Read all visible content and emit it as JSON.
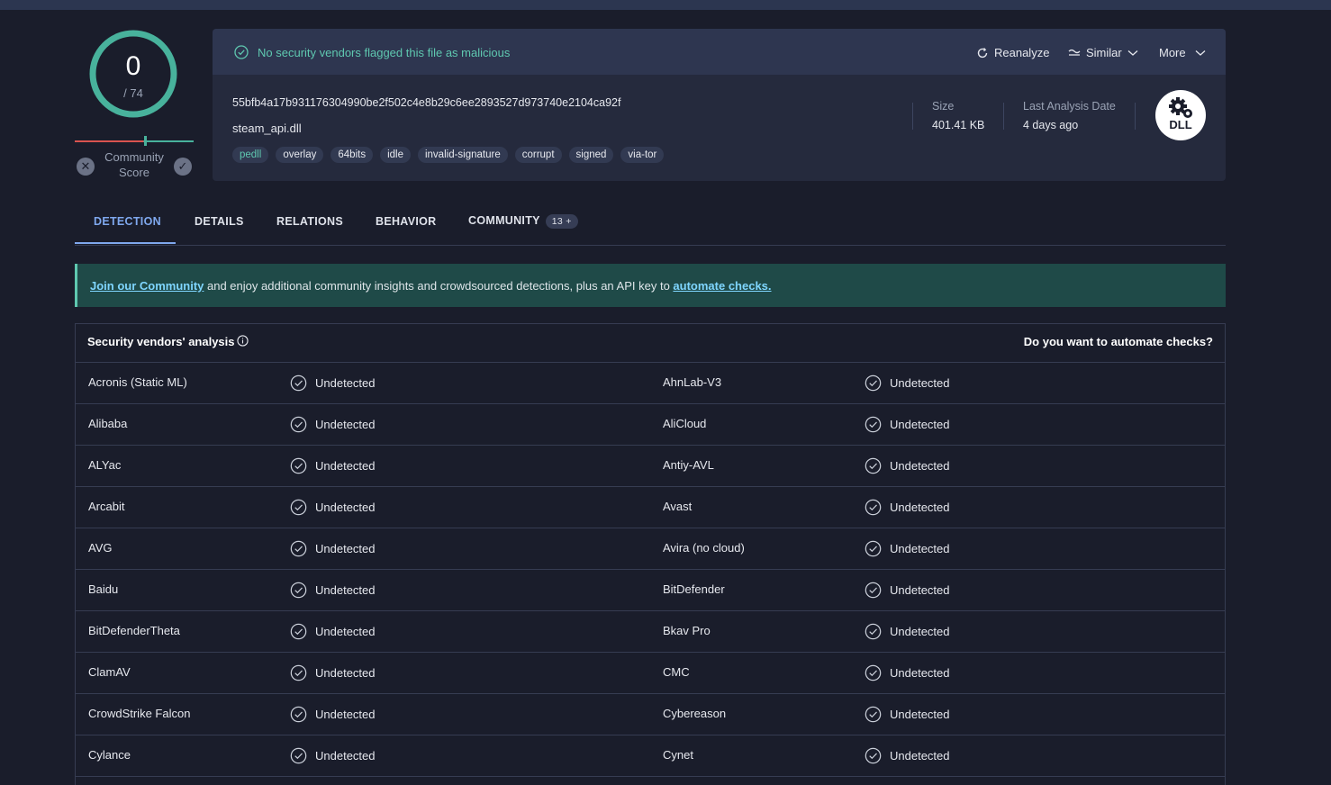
{
  "score": {
    "detected": "0",
    "total": "/ 74",
    "community_label_1": "Community",
    "community_label_2": "Score"
  },
  "header": {
    "status": "No security vendors flagged this file as malicious",
    "reanalyze": "Reanalyze",
    "similar": "Similar",
    "more": "More",
    "hash": "55bfb4a17b931176304990be2f502c4e8b29c6ee2893527d973740e2104ca92f",
    "filename": "steam_api.dll",
    "tags": [
      "pedll",
      "overlay",
      "64bits",
      "idle",
      "invalid-signature",
      "corrupt",
      "signed",
      "via-tor"
    ],
    "size_label": "Size",
    "size_value": "401.41 KB",
    "date_label": "Last Analysis Date",
    "date_value": "4 days ago",
    "filetype": "DLL"
  },
  "tabs": {
    "detection": "DETECTION",
    "details": "DETAILS",
    "relations": "RELATIONS",
    "behavior": "BEHAVIOR",
    "community": "COMMUNITY",
    "community_badge": "13 +"
  },
  "banner": {
    "link1": "Join our Community",
    "middle": " and enjoy additional community insights and crowdsourced detections, plus an API key to ",
    "link2": "automate checks."
  },
  "vendors": {
    "title": "Security vendors' analysis",
    "automate": "Do you want to automate checks?",
    "rows": [
      {
        "left": "Acronis (Static ML)",
        "left_result": "Undetected",
        "right": "AhnLab-V3",
        "right_result": "Undetected"
      },
      {
        "left": "Alibaba",
        "left_result": "Undetected",
        "right": "AliCloud",
        "right_result": "Undetected"
      },
      {
        "left": "ALYac",
        "left_result": "Undetected",
        "right": "Antiy-AVL",
        "right_result": "Undetected"
      },
      {
        "left": "Arcabit",
        "left_result": "Undetected",
        "right": "Avast",
        "right_result": "Undetected"
      },
      {
        "left": "AVG",
        "left_result": "Undetected",
        "right": "Avira (no cloud)",
        "right_result": "Undetected"
      },
      {
        "left": "Baidu",
        "left_result": "Undetected",
        "right": "BitDefender",
        "right_result": "Undetected"
      },
      {
        "left": "BitDefenderTheta",
        "left_result": "Undetected",
        "right": "Bkav Pro",
        "right_result": "Undetected"
      },
      {
        "left": "ClamAV",
        "left_result": "Undetected",
        "right": "CMC",
        "right_result": "Undetected"
      },
      {
        "left": "CrowdStrike Falcon",
        "left_result": "Undetected",
        "right": "Cybereason",
        "right_result": "Undetected"
      },
      {
        "left": "Cylance",
        "left_result": "Undetected",
        "right": "Cynet",
        "right_result": "Undetected"
      }
    ]
  },
  "colors": {
    "accent": "#5fc8b0",
    "tab_active": "#7fa8ee",
    "background": "#1a1d2b"
  }
}
